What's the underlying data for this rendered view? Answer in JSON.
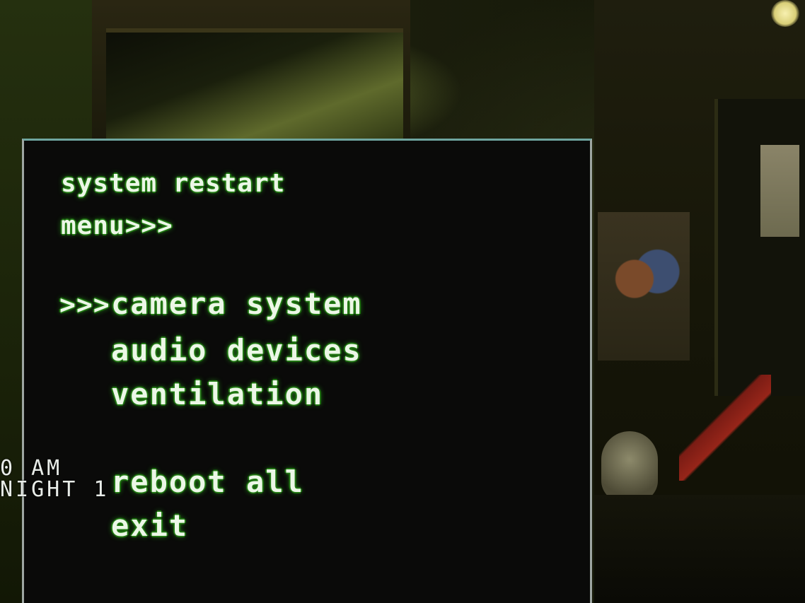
{
  "menu": {
    "title_line1": "system restart",
    "title_line2": "menu>>>",
    "cursor": ">>>",
    "options": [
      {
        "label": "camera system",
        "selected": true
      },
      {
        "label": "audio devices",
        "selected": false
      },
      {
        "label": "ventilation",
        "selected": false
      },
      {
        "label": "reboot all",
        "selected": false
      },
      {
        "label": "exit",
        "selected": false
      }
    ]
  },
  "hud": {
    "time": "0 AM",
    "night": "NIGHT 1"
  },
  "colors": {
    "text": "#ecf7e7",
    "glow": "#2aa51a",
    "panel_background": "#0a0a09",
    "panel_border": "#9ea6a2"
  }
}
